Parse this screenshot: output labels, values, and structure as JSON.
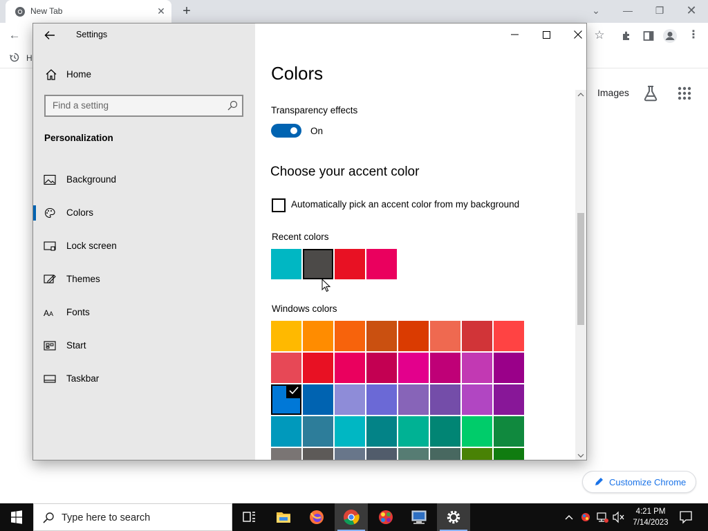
{
  "chrome": {
    "tab_title": "New Tab",
    "bookmark_label": "H",
    "images_link": "Images",
    "customize_label": "Customize Chrome"
  },
  "settings": {
    "window_title": "Settings",
    "home_label": "Home",
    "search_placeholder": "Find a setting",
    "section_heading": "Personalization",
    "nav_items": [
      {
        "label": "Background",
        "icon": "picture-icon",
        "selected": false
      },
      {
        "label": "Colors",
        "icon": "palette-icon",
        "selected": true
      },
      {
        "label": "Lock screen",
        "icon": "lock-screen-icon",
        "selected": false
      },
      {
        "label": "Themes",
        "icon": "themes-icon",
        "selected": false
      },
      {
        "label": "Fonts",
        "icon": "fonts-icon",
        "selected": false
      },
      {
        "label": "Start",
        "icon": "start-icon",
        "selected": false
      },
      {
        "label": "Taskbar",
        "icon": "taskbar-icon",
        "selected": false
      }
    ],
    "page_title": "Colors",
    "transparency_label": "Transparency effects",
    "transparency_state": "On",
    "accent_heading": "Choose your accent color",
    "auto_pick_label": "Automatically pick an accent color from my background",
    "recent_label": "Recent colors",
    "recent_colors": [
      "#00b7c3",
      "#4c4a48",
      "#e81123",
      "#ea005e"
    ],
    "recent_selected_index": 1,
    "windows_label": "Windows colors",
    "windows_colors": [
      "#ffb900",
      "#ff8c00",
      "#f7630c",
      "#ca5010",
      "#da3b01",
      "#ef6950",
      "#d13438",
      "#ff4343",
      "#e74856",
      "#e81123",
      "#ea005e",
      "#c30052",
      "#e3008c",
      "#bf0077",
      "#c239b3",
      "#9a0089",
      "#0078d7",
      "#0063b1",
      "#8e8cd8",
      "#6b69d6",
      "#8764b8",
      "#744da9",
      "#b146c2",
      "#881798",
      "#0099bc",
      "#2d7d9a",
      "#00b7c3",
      "#038387",
      "#00b294",
      "#018574",
      "#00cc6a",
      "#10893e",
      "#7a7574",
      "#5d5a58",
      "#68768a",
      "#515c6b",
      "#567c73",
      "#486860",
      "#498205",
      "#107c10"
    ],
    "windows_selected_index": 16
  },
  "taskbar": {
    "search_placeholder": "Type here to search",
    "time": "4:21 PM",
    "date": "7/14/2023"
  }
}
